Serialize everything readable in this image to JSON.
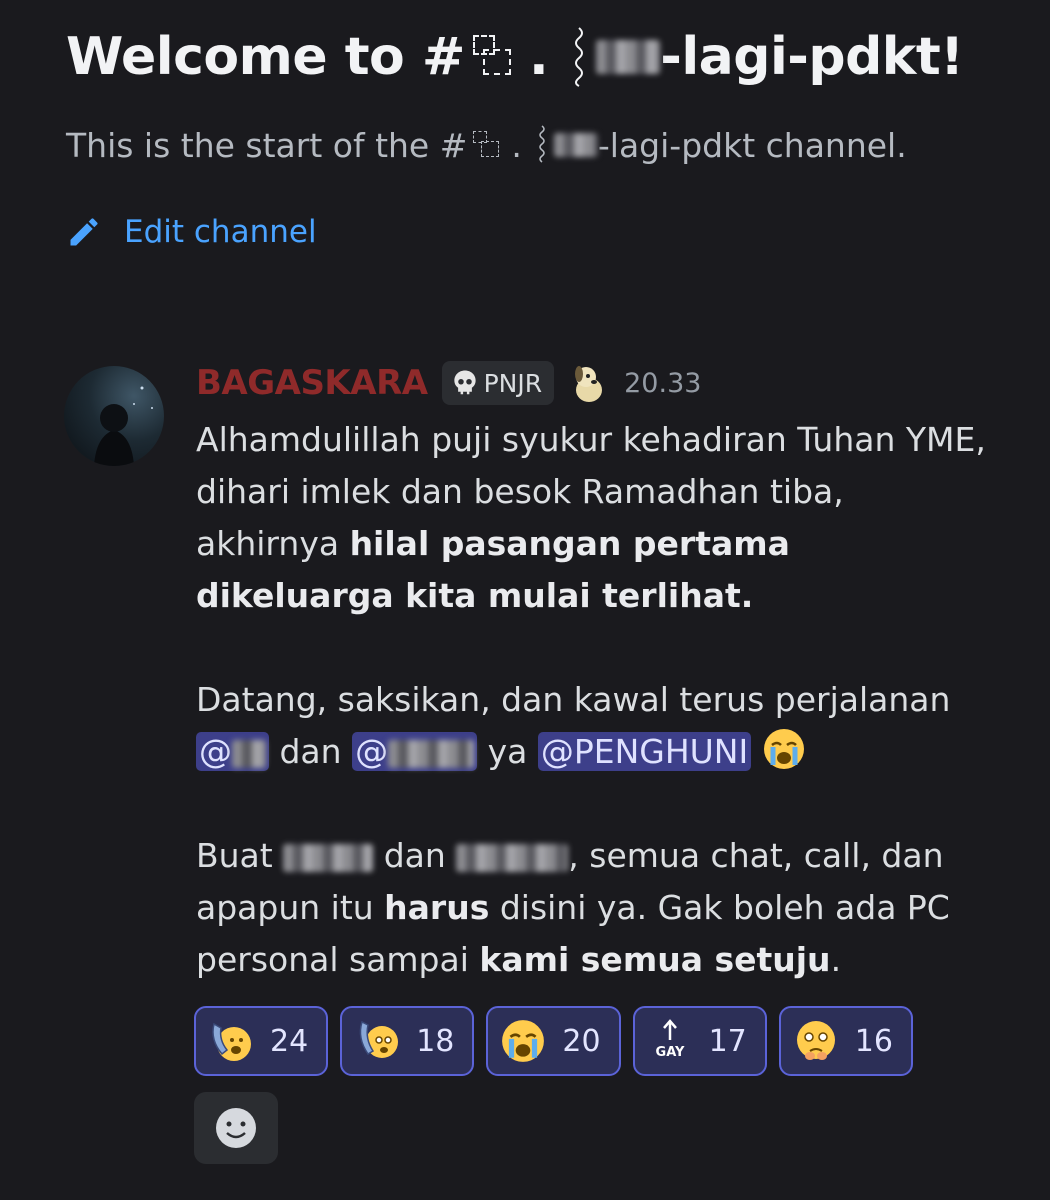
{
  "channel": {
    "welcome_prefix": "Welcome to #",
    "welcome_suffix": "-lagi-pdkt!",
    "sub_prefix": "This is the start of the #",
    "sub_suffix": "-lagi-pdkt channel.",
    "dot": ".",
    "edit_label": "Edit channel"
  },
  "message": {
    "username": "BAGASKARA",
    "role_tag": "PNJR",
    "timestamp": "20.33",
    "p1_text": "Alhamdulillah puji syukur kehadiran Tuhan YME, dihari imlek dan besok Ramadhan tiba, akhirnya ",
    "p1_bold": "hilal pasangan pertama dikeluarga kita mulai terlihat.",
    "p2_text": "Datang, saksikan, dan kawal terus perjalanan ",
    "mention_at_1": "@",
    "p2_dan": " dan ",
    "mention_at_2": "@",
    "p2_ya": " ya ",
    "mention_group": "@PENGHUNI",
    "p3_buat": "Buat ",
    "p3_dan": "dan ",
    "p3_mid": ", semua chat, call, dan apapun itu ",
    "p3_bold1": "harus",
    "p3_mid2": " disini ya. Gak boleh ada PC personal sampai ",
    "p3_bold2": "kami semua setuju",
    "p3_end": "."
  },
  "reactions": [
    {
      "emoji": "phone-call-emoji",
      "count": "24"
    },
    {
      "emoji": "phone-call-emoji-2",
      "count": "18"
    },
    {
      "emoji": "loudly-crying-face",
      "count": "20"
    },
    {
      "emoji": "gay-arrow-emoji",
      "count": "17",
      "text": "GAY"
    },
    {
      "emoji": "face-holding-back-tears",
      "count": "16"
    }
  ],
  "colors": {
    "background": "#1a1a1e",
    "username": "#8f2a2a",
    "link": "#4aa3ff",
    "mention_bg": "#3d3f8a",
    "reaction_border": "#5b63d8"
  }
}
